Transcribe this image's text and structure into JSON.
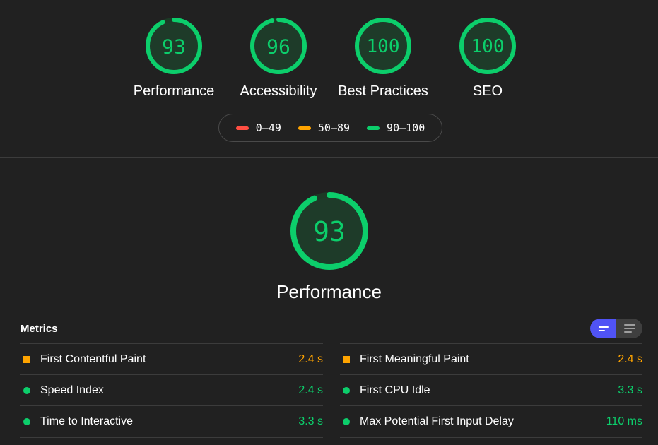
{
  "colors": {
    "pass": "#0cce6b",
    "average": "#ffa400",
    "fail": "#ff4e42",
    "accent": "#5053f5"
  },
  "categories": [
    {
      "score": "93",
      "score_fraction": 0.93,
      "label": "Performance"
    },
    {
      "score": "96",
      "score_fraction": 0.96,
      "label": "Accessibility"
    },
    {
      "score": "100",
      "score_fraction": 1.0,
      "label": "Best Practices"
    },
    {
      "score": "100",
      "score_fraction": 1.0,
      "label": "SEO"
    }
  ],
  "legend": [
    {
      "range": "0–49",
      "color": "#ff4e42"
    },
    {
      "range": "50–89",
      "color": "#ffa400"
    },
    {
      "range": "90–100",
      "color": "#0cce6b"
    }
  ],
  "performance": {
    "score": "93",
    "score_fraction": 0.93,
    "label": "Performance"
  },
  "metrics": {
    "title": "Metrics",
    "left": [
      {
        "name": "First Contentful Paint",
        "value": "2.4 s",
        "status": "average"
      },
      {
        "name": "Speed Index",
        "value": "2.4 s",
        "status": "pass"
      },
      {
        "name": "Time to Interactive",
        "value": "3.3 s",
        "status": "pass"
      }
    ],
    "right": [
      {
        "name": "First Meaningful Paint",
        "value": "2.4 s",
        "status": "average"
      },
      {
        "name": "First CPU Idle",
        "value": "3.3 s",
        "status": "pass"
      },
      {
        "name": "Max Potential First Input Delay",
        "value": "110 ms",
        "status": "pass"
      }
    ]
  }
}
